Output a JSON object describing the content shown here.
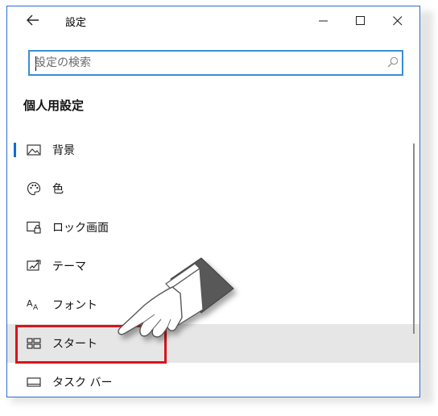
{
  "window": {
    "title": "設定"
  },
  "titlebar": {
    "back_icon": "back-arrow-icon",
    "minimize_icon": "minimize-icon",
    "maximize_icon": "maximize-icon",
    "close_icon": "close-icon"
  },
  "search": {
    "placeholder": "設定の検索",
    "value": "",
    "icon": "search-icon"
  },
  "section": {
    "title": "個人用設定"
  },
  "nav": {
    "items": [
      {
        "label": "背景",
        "icon": "picture-icon",
        "selected": true
      },
      {
        "label": "色",
        "icon": "palette-icon"
      },
      {
        "label": "ロック画面",
        "icon": "lock-screen-icon"
      },
      {
        "label": "テーマ",
        "icon": "theme-icon"
      },
      {
        "label": "フォント",
        "icon": "font-icon"
      },
      {
        "label": "スタート",
        "icon": "start-tiles-icon",
        "hovered": true
      },
      {
        "label": "タスク バー",
        "icon": "taskbar-icon"
      }
    ]
  },
  "colors": {
    "accent": "#0a6dd8",
    "search_border": "#3a8ed4",
    "hover_bg": "#e6e6e6",
    "highlight_box": "#d8141c"
  },
  "annotation": {
    "pointer_icon": "pointing-hand-icon"
  }
}
